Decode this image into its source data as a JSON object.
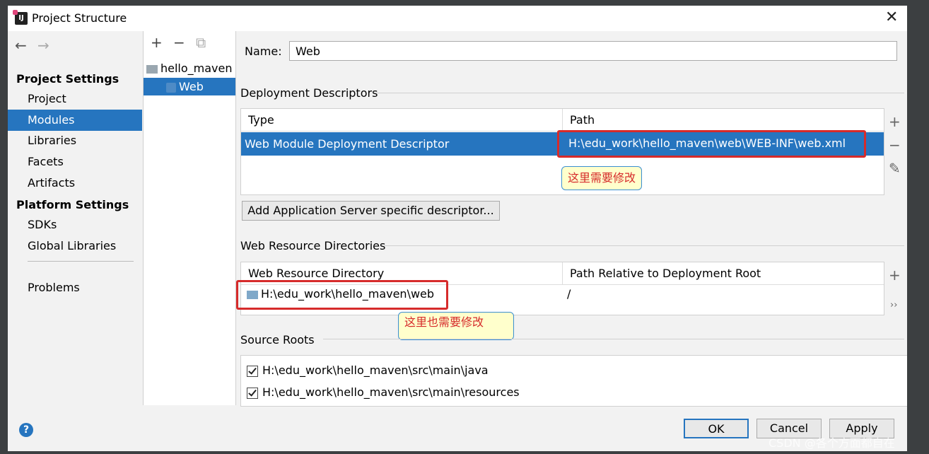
{
  "window": {
    "title": "Project Structure",
    "close": "✕"
  },
  "nav": {
    "back": "←",
    "forward": "→",
    "project_settings": "Project Settings",
    "project_items": [
      "Project",
      "Modules",
      "Libraries",
      "Facets",
      "Artifacts"
    ],
    "platform_settings": "Platform Settings",
    "platform_items": [
      "SDKs",
      "Global Libraries"
    ],
    "problems": "Problems"
  },
  "modules": {
    "toolbar": {
      "add": "+",
      "remove": "−",
      "copy": "⧉"
    },
    "tree": [
      "hello_maven",
      "Web"
    ]
  },
  "content": {
    "name_label": "Name:",
    "name_value": "Web",
    "deployment": {
      "title": "Deployment Descriptors",
      "col_type": "Type",
      "col_path": "Path",
      "row_type": "Web Module Deployment Descriptor",
      "row_path": "H:\\edu_work\\hello_maven\\web\\WEB-INF\\web.xml",
      "add_button": "Add Application Server specific descriptor...",
      "note": "这里需要修改"
    },
    "web_resources": {
      "title": "Web Resource Directories",
      "col_dir": "Web Resource Directory",
      "col_rel": "Path Relative to Deployment Root",
      "row_dir": "H:\\edu_work\\hello_maven\\web",
      "row_rel": "/",
      "more": "››",
      "note": "这里也需要修改"
    },
    "source_roots": {
      "title": "Source Roots",
      "items": [
        "H:\\edu_work\\hello_maven\\src\\main\\java",
        "H:\\edu_work\\hello_maven\\src\\main\\resources"
      ]
    },
    "side": {
      "add": "+",
      "remove": "−",
      "edit": "✎"
    }
  },
  "buttons": {
    "ok": "OK",
    "cancel": "Cancel",
    "apply": "Apply",
    "help": "?"
  },
  "watermark": "CSDN @各个方面都自在"
}
